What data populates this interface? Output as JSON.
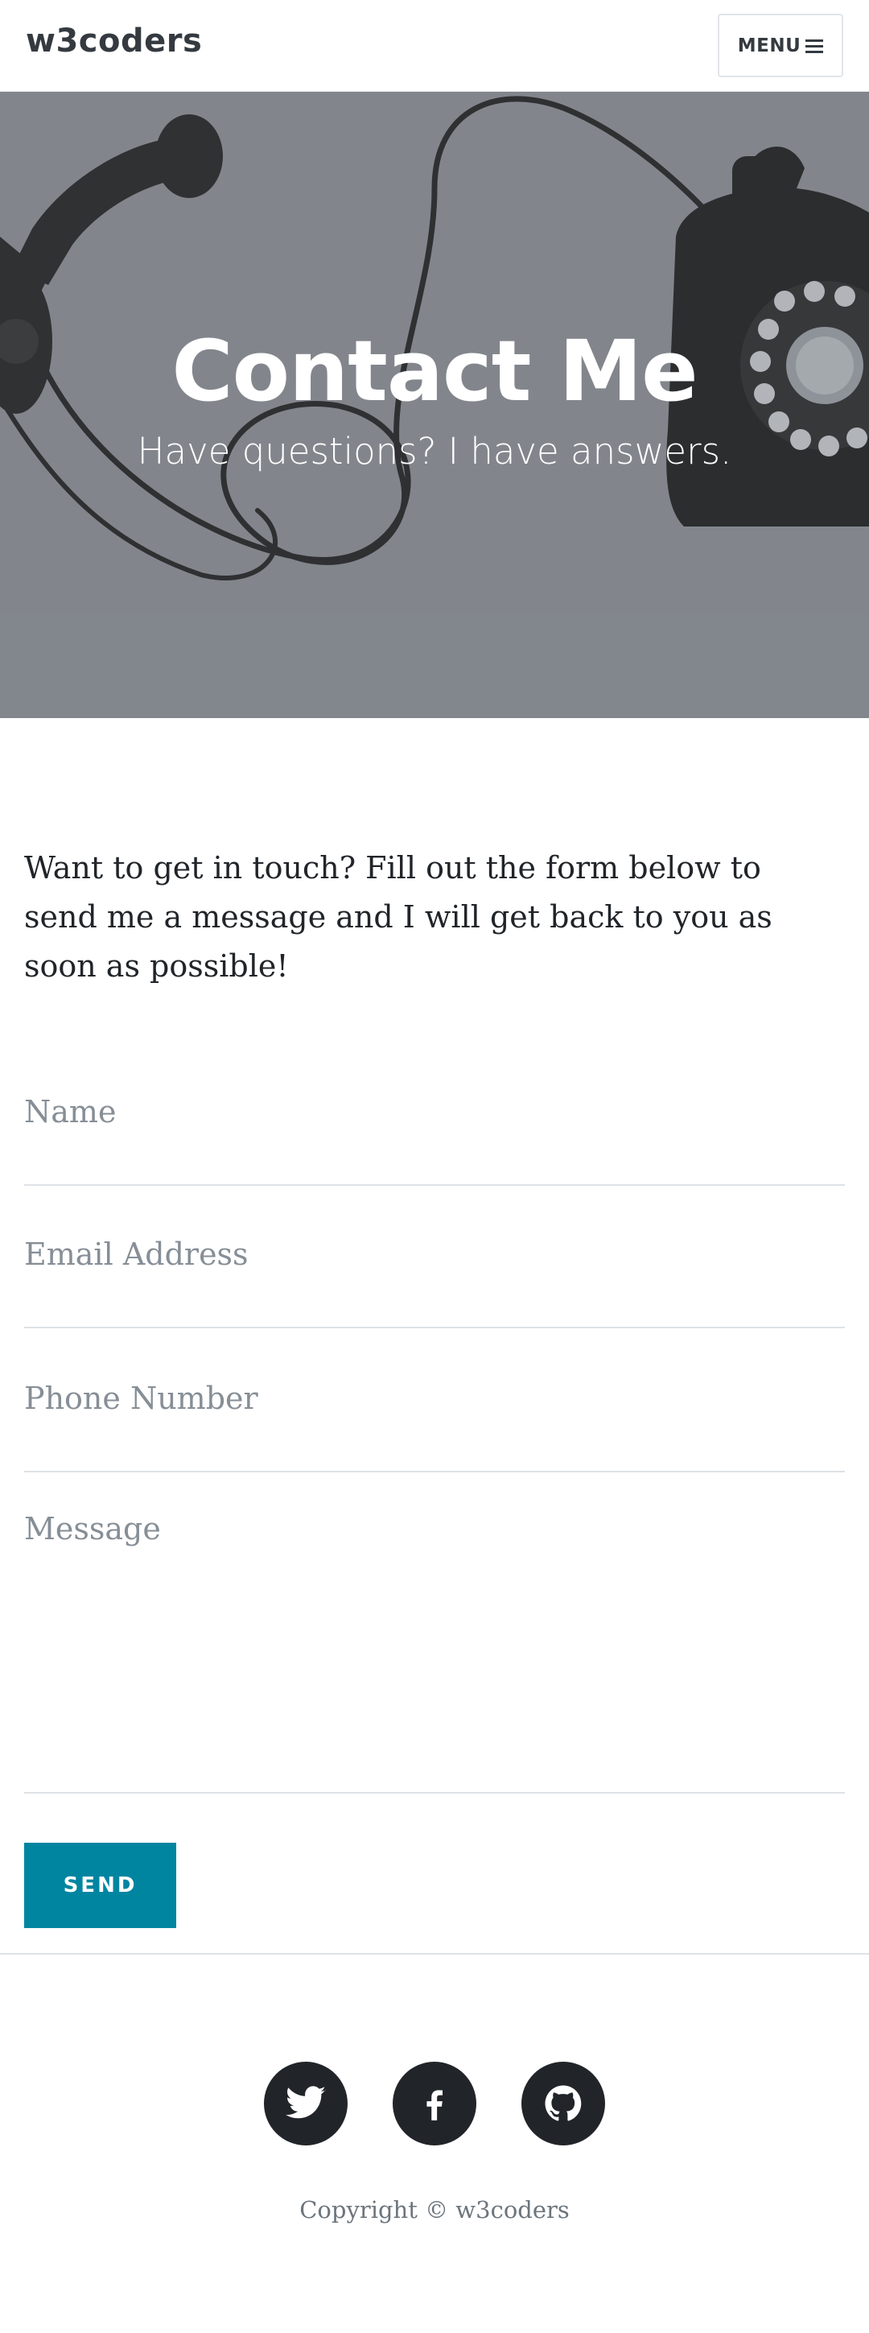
{
  "navbar": {
    "brand": "w3coders",
    "menu_label": "MENU"
  },
  "hero": {
    "title": "Contact Me",
    "subtitle": "Have questions? I have answers."
  },
  "content": {
    "intro": "Want to get in touch? Fill out the form below to send me a message and I will get back to you as soon as possible!"
  },
  "form": {
    "name_placeholder": "Name",
    "email_placeholder": "Email Address",
    "phone_placeholder": "Phone Number",
    "message_placeholder": "Message",
    "send_label": "SEND"
  },
  "footer": {
    "social": [
      {
        "icon": "twitter-icon"
      },
      {
        "icon": "facebook-icon"
      },
      {
        "icon": "github-icon"
      }
    ],
    "copyright": "Copyright © w3coders"
  },
  "colors": {
    "accent": "#0085a1",
    "dark": "#212529"
  }
}
